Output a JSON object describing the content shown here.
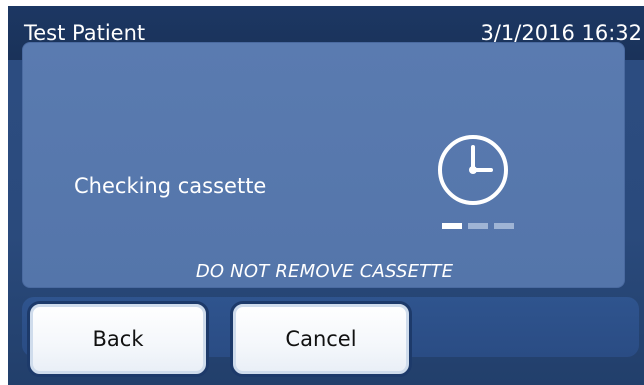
{
  "header": {
    "patient_name": "Test Patient",
    "datetime": "3/1/2016 16:32"
  },
  "message": {
    "status": "Checking cassette",
    "warning": "DO NOT REMOVE CASSETTE",
    "icon": "clock-icon",
    "progress": {
      "total_steps": 3,
      "active_step": 1
    }
  },
  "buttons": {
    "back": "Back",
    "cancel": "Cancel"
  },
  "colors": {
    "header": "#1c3763",
    "panel": "#5a7bb0",
    "device": "#2a4a7c",
    "button_border": "#1d3a6a"
  }
}
